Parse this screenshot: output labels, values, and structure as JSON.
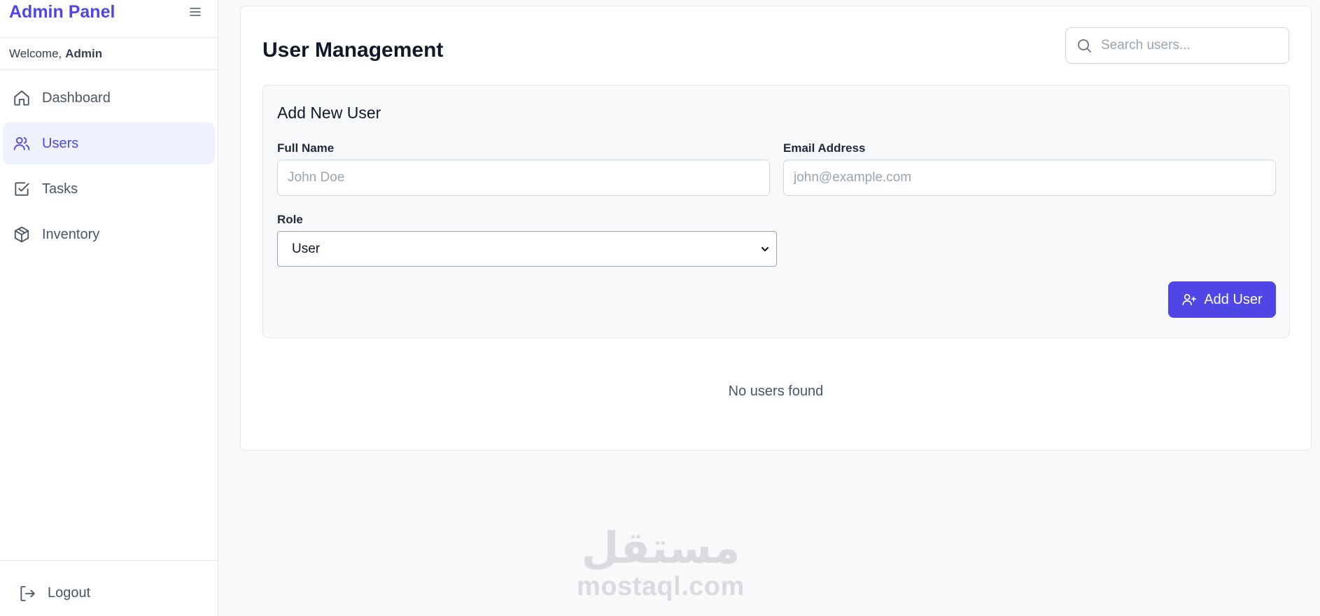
{
  "sidebar": {
    "brand": "Admin Panel",
    "welcome_prefix": "Welcome,",
    "welcome_user": "Admin",
    "items": [
      {
        "label": "Dashboard",
        "icon": "home-icon",
        "active": false
      },
      {
        "label": "Users",
        "icon": "users-icon",
        "active": true
      },
      {
        "label": "Tasks",
        "icon": "check-square-icon",
        "active": false
      },
      {
        "label": "Inventory",
        "icon": "box-icon",
        "active": false
      }
    ],
    "logout_label": "Logout"
  },
  "main": {
    "title": "User Management",
    "search_placeholder": "Search users...",
    "form": {
      "title": "Add New User",
      "full_name_label": "Full Name",
      "full_name_placeholder": "John Doe",
      "email_label": "Email Address",
      "email_placeholder": "john@example.com",
      "role_label": "Role",
      "role_value": "User",
      "submit_label": "Add User"
    },
    "empty_message": "No users found"
  },
  "watermark": {
    "arabic": "مستقل",
    "latin": "mostaql.com"
  },
  "colors": {
    "accent": "#4f46e5",
    "active_bg": "#eef2ff",
    "page_bg": "#f8f9fb"
  }
}
